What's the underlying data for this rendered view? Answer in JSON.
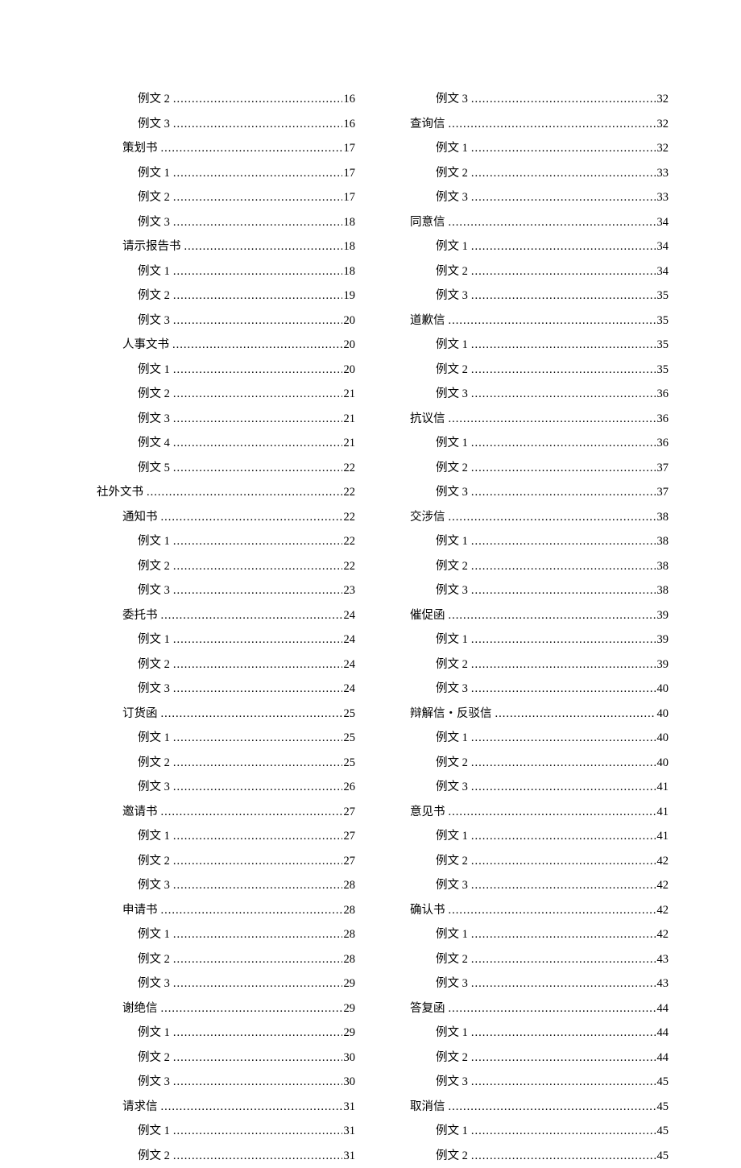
{
  "left": [
    {
      "label": "例文 2",
      "page": "16",
      "indent": 3
    },
    {
      "label": "例文 3",
      "page": "16",
      "indent": 3
    },
    {
      "label": "策划书",
      "page": "17",
      "indent": 2
    },
    {
      "label": "例文 1",
      "page": "17",
      "indent": 3
    },
    {
      "label": "例文 2",
      "page": "17",
      "indent": 3
    },
    {
      "label": "例文 3",
      "page": "18",
      "indent": 3
    },
    {
      "label": "请示报告书",
      "page": "18",
      "indent": 2
    },
    {
      "label": "例文 1",
      "page": "18",
      "indent": 3
    },
    {
      "label": "例文 2",
      "page": "19",
      "indent": 3
    },
    {
      "label": "例文 3",
      "page": "20",
      "indent": 3
    },
    {
      "label": "人事文书",
      "page": "20",
      "indent": 2
    },
    {
      "label": "例文 1",
      "page": "20",
      "indent": 3
    },
    {
      "label": "例文 2",
      "page": "21",
      "indent": 3
    },
    {
      "label": "例文 3",
      "page": "21",
      "indent": 3
    },
    {
      "label": "例文 4",
      "page": "21",
      "indent": 3
    },
    {
      "label": "例文 5",
      "page": "22",
      "indent": 3
    },
    {
      "label": "社外文书",
      "page": "22",
      "indent": 1
    },
    {
      "label": "通知书",
      "page": "22",
      "indent": 2
    },
    {
      "label": "例文 1",
      "page": "22",
      "indent": 3
    },
    {
      "label": "例文 2",
      "page": "22",
      "indent": 3
    },
    {
      "label": "例文 3",
      "page": "23",
      "indent": 3
    },
    {
      "label": "委托书",
      "page": "24",
      "indent": 2
    },
    {
      "label": "例文 1",
      "page": "24",
      "indent": 3
    },
    {
      "label": "例文 2",
      "page": "24",
      "indent": 3
    },
    {
      "label": "例文 3",
      "page": "24",
      "indent": 3
    },
    {
      "label": "订货函",
      "page": "25",
      "indent": 2
    },
    {
      "label": "例文 1",
      "page": "25",
      "indent": 3
    },
    {
      "label": "例文 2",
      "page": "25",
      "indent": 3
    },
    {
      "label": "例文 3",
      "page": "26",
      "indent": 3
    },
    {
      "label": "邀请书",
      "page": "27",
      "indent": 2
    },
    {
      "label": "例文 1",
      "page": "27",
      "indent": 3
    },
    {
      "label": "例文 2",
      "page": "27",
      "indent": 3
    },
    {
      "label": "例文 3",
      "page": "28",
      "indent": 3
    },
    {
      "label": "申请书",
      "page": "28",
      "indent": 2
    },
    {
      "label": "例文 1",
      "page": "28",
      "indent": 3
    },
    {
      "label": "例文 2",
      "page": "28",
      "indent": 3
    },
    {
      "label": "例文 3",
      "page": "29",
      "indent": 3
    },
    {
      "label": "谢绝信",
      "page": "29",
      "indent": 2
    },
    {
      "label": "例文 1",
      "page": "29",
      "indent": 3
    },
    {
      "label": "例文 2",
      "page": "30",
      "indent": 3
    },
    {
      "label": "例文 3",
      "page": "30",
      "indent": 3
    },
    {
      "label": "请求信",
      "page": "31",
      "indent": 2
    },
    {
      "label": "例文 1",
      "page": "31",
      "indent": 3
    },
    {
      "label": "例文 2",
      "page": "31",
      "indent": 3
    }
  ],
  "right": [
    {
      "label": "例文 3",
      "page": "32",
      "indent": 2
    },
    {
      "label": "查询信",
      "page": "32",
      "indent": 1
    },
    {
      "label": "例文 1",
      "page": "32",
      "indent": 2
    },
    {
      "label": "例文 2",
      "page": "33",
      "indent": 2
    },
    {
      "label": "例文 3",
      "page": "33",
      "indent": 2
    },
    {
      "label": "同意信",
      "page": "34",
      "indent": 1
    },
    {
      "label": "例文 1",
      "page": "34",
      "indent": 2
    },
    {
      "label": "例文 2",
      "page": "34",
      "indent": 2
    },
    {
      "label": "例文 3",
      "page": "35",
      "indent": 2
    },
    {
      "label": "道歉信",
      "page": "35",
      "indent": 1
    },
    {
      "label": "例文 1",
      "page": "35",
      "indent": 2
    },
    {
      "label": "例文 2",
      "page": "35",
      "indent": 2
    },
    {
      "label": "例文 3",
      "page": "36",
      "indent": 2
    },
    {
      "label": "抗议信",
      "page": "36",
      "indent": 1
    },
    {
      "label": "例文 1",
      "page": "36",
      "indent": 2
    },
    {
      "label": "例文 2",
      "page": "37",
      "indent": 2
    },
    {
      "label": "例文 3",
      "page": "37",
      "indent": 2
    },
    {
      "label": "交涉信",
      "page": "38",
      "indent": 1
    },
    {
      "label": "例文 1",
      "page": "38",
      "indent": 2
    },
    {
      "label": "例文 2",
      "page": "38",
      "indent": 2
    },
    {
      "label": "例文 3",
      "page": "38",
      "indent": 2
    },
    {
      "label": "催促函",
      "page": "39",
      "indent": 1
    },
    {
      "label": "例文 1",
      "page": "39",
      "indent": 2
    },
    {
      "label": "例文 2",
      "page": "39",
      "indent": 2
    },
    {
      "label": "例文 3",
      "page": "40",
      "indent": 2
    },
    {
      "label": "辩解信・反驳信",
      "page": "40",
      "indent": 1
    },
    {
      "label": "例文 1",
      "page": "40",
      "indent": 2
    },
    {
      "label": "例文 2",
      "page": "40",
      "indent": 2
    },
    {
      "label": "例文 3",
      "page": "41",
      "indent": 2
    },
    {
      "label": "意见书",
      "page": "41",
      "indent": 1
    },
    {
      "label": "例文 1",
      "page": "41",
      "indent": 2
    },
    {
      "label": "例文 2",
      "page": "42",
      "indent": 2
    },
    {
      "label": "例文 3",
      "page": "42",
      "indent": 2
    },
    {
      "label": "确认书",
      "page": "42",
      "indent": 1
    },
    {
      "label": "例文 1",
      "page": "42",
      "indent": 2
    },
    {
      "label": "例文 2",
      "page": "43",
      "indent": 2
    },
    {
      "label": "例文 3",
      "page": "43",
      "indent": 2
    },
    {
      "label": "答复函",
      "page": "44",
      "indent": 1
    },
    {
      "label": "例文 1",
      "page": "44",
      "indent": 2
    },
    {
      "label": "例文 2",
      "page": "44",
      "indent": 2
    },
    {
      "label": "例文 3",
      "page": "45",
      "indent": 2
    },
    {
      "label": "取消信",
      "page": "45",
      "indent": 1
    },
    {
      "label": "例文 1",
      "page": "45",
      "indent": 2
    },
    {
      "label": "例文 2",
      "page": "45",
      "indent": 2
    }
  ]
}
